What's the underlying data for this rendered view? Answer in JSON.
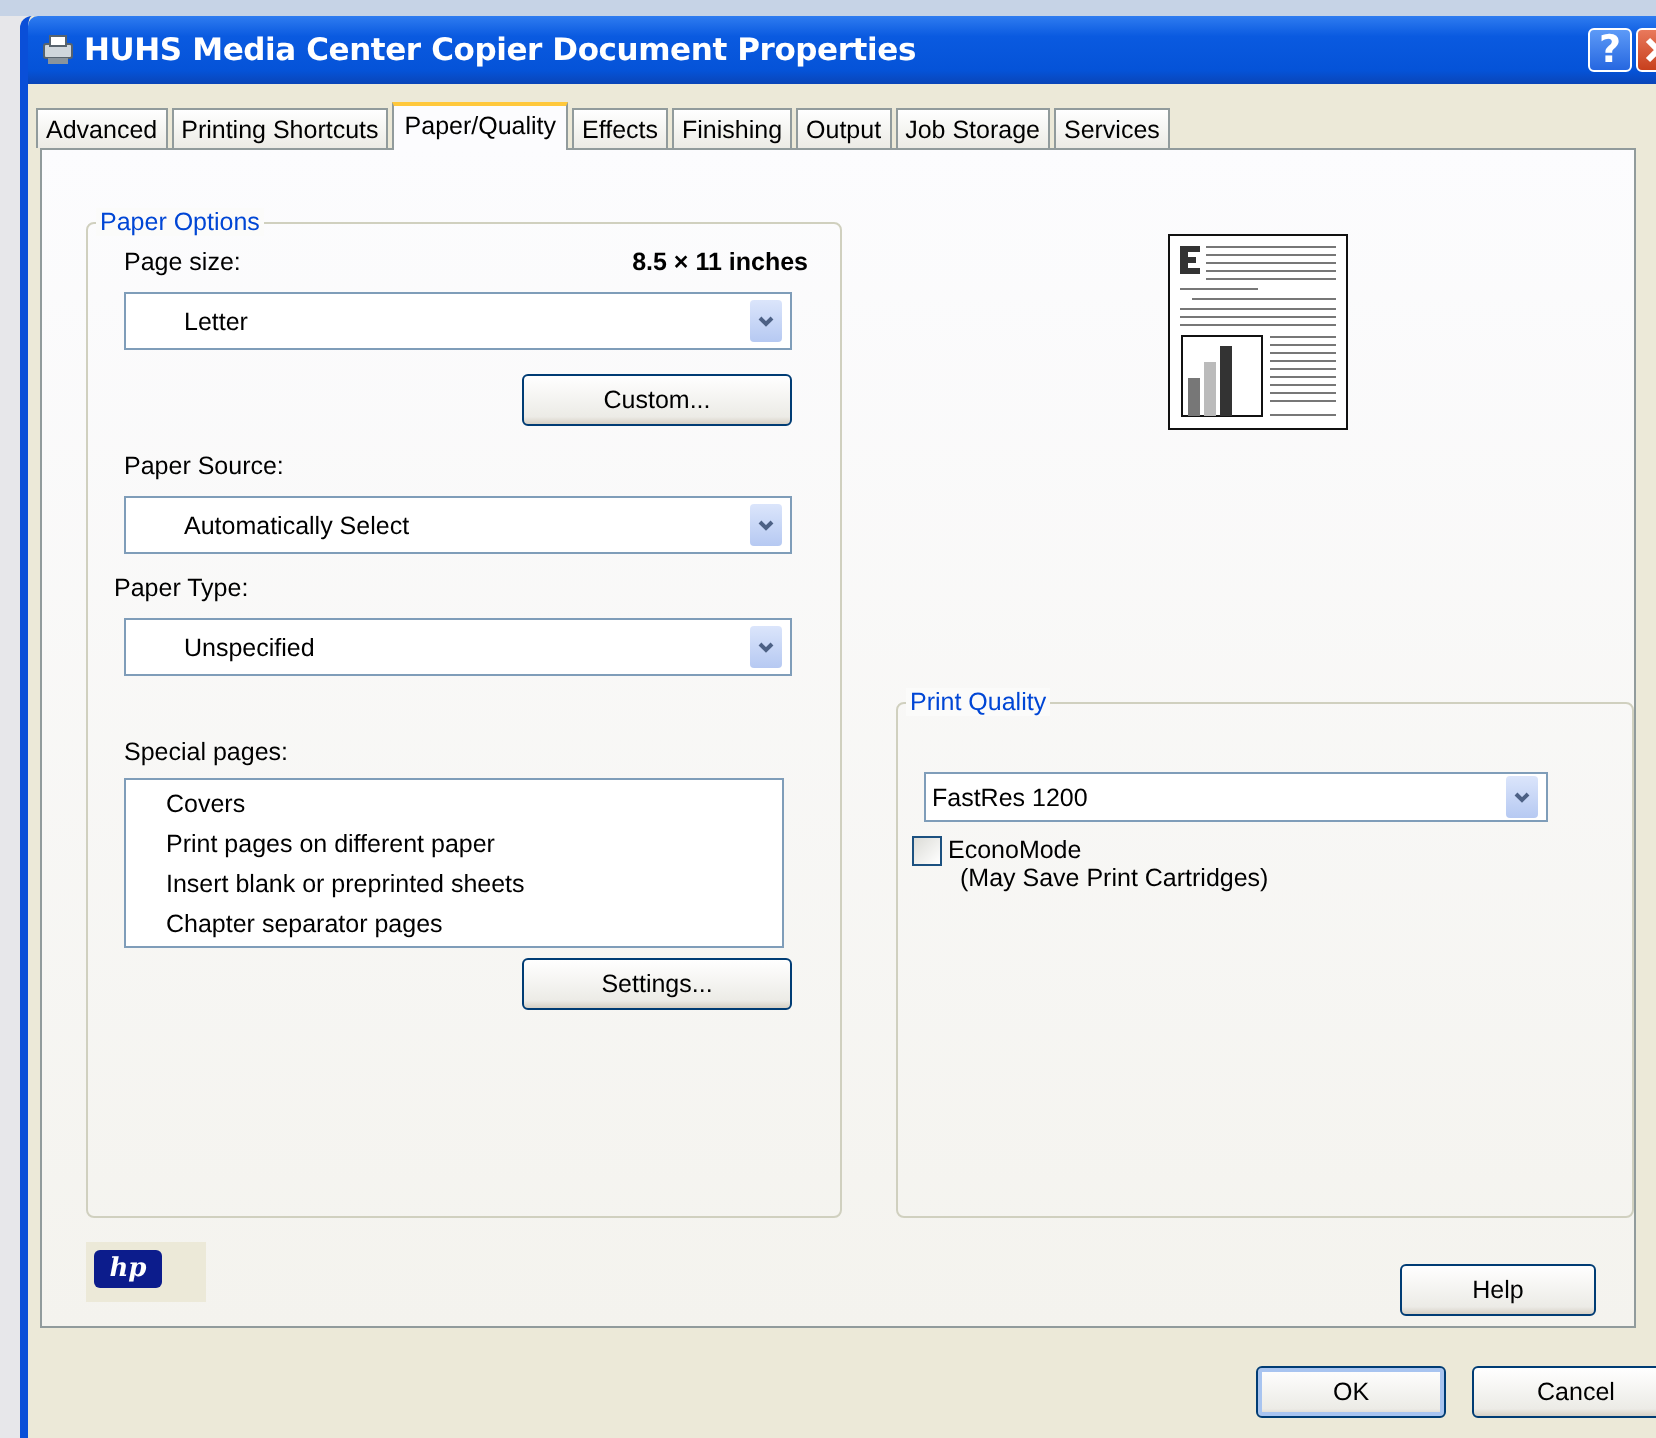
{
  "window": {
    "title": "HUHS Media Center Copier Document Properties",
    "help_glyph": "?"
  },
  "tabs": [
    {
      "label": "Advanced",
      "selected": false
    },
    {
      "label": "Printing Shortcuts",
      "selected": false
    },
    {
      "label": "Paper/Quality",
      "selected": true
    },
    {
      "label": "Effects",
      "selected": false
    },
    {
      "label": "Finishing",
      "selected": false
    },
    {
      "label": "Output",
      "selected": false
    },
    {
      "label": "Job Storage",
      "selected": false
    },
    {
      "label": "Services",
      "selected": false
    }
  ],
  "paper_options": {
    "legend": "Paper Options",
    "page_size_label": "Page size:",
    "page_size_dims": "8.5 × 11 inches",
    "page_size": "Letter",
    "custom_button": "Custom...",
    "paper_source_label": "Paper Source:",
    "paper_source": "Automatically Select",
    "paper_type_label": "Paper Type:",
    "paper_type": "Unspecified",
    "special_pages_label": "Special pages:",
    "special_pages": [
      {
        "label": "Covers",
        "selected": false
      },
      {
        "label": "Print pages on different paper",
        "selected": false
      },
      {
        "label": "Insert blank or preprinted sheets",
        "selected": false
      },
      {
        "label": "Chapter separator pages",
        "selected": false
      }
    ],
    "settings_button": "Settings..."
  },
  "print_quality": {
    "legend": "Print Quality",
    "resolution": "FastRes 1200",
    "econo_mode": {
      "label": "EconoMode",
      "note": "(May Save Print Cartridges)",
      "checked": false
    }
  },
  "logo": "hp",
  "help_button": "Help",
  "buttons": [
    "OK",
    "Cancel"
  ]
}
